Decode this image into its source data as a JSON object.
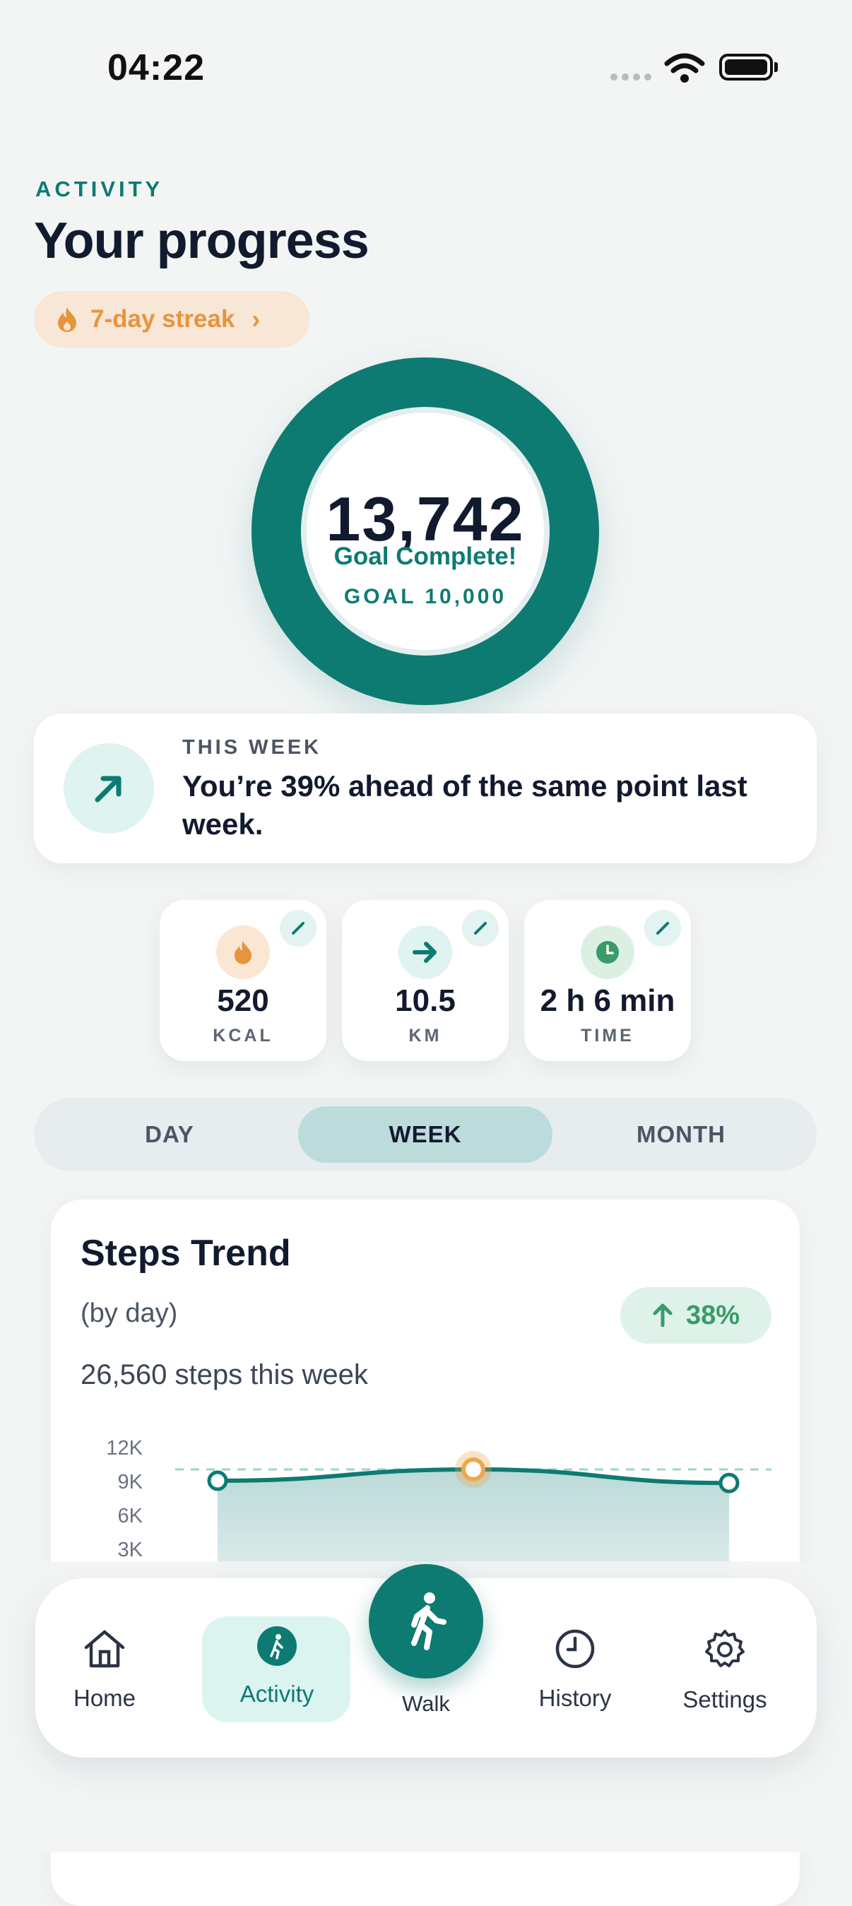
{
  "status_bar": {
    "time": "04:22"
  },
  "header": {
    "eyebrow": "ACTIVITY",
    "title": "Your progress",
    "streak_label": "7-day streak"
  },
  "progress": {
    "steps": "13,742",
    "status": "Goal Complete!",
    "goal": "GOAL 10,000",
    "fraction": 1.0
  },
  "week_card": {
    "eyebrow": "THIS WEEK",
    "text": "You’re 39% ahead of the same point last week."
  },
  "metrics": [
    {
      "value": "520",
      "unit": "KCAL",
      "icon": "flame-icon",
      "color": "#e6953d"
    },
    {
      "value": "10.5",
      "unit": "KM",
      "icon": "arrow-right-icon",
      "color": "#0d7b72"
    },
    {
      "value": "2 h 6 min",
      "unit": "TIME",
      "icon": "clock-icon",
      "color": "#3a9a6a"
    }
  ],
  "tabs": {
    "day": "DAY",
    "week": "WEEK",
    "month": "MONTH",
    "selected": "WEEK"
  },
  "steps_card": {
    "title": "Steps Trend",
    "subtitle": "(by day)",
    "total": "26,560 steps this week",
    "badge": "38%"
  },
  "chart_data": {
    "type": "area",
    "y_ticks": [
      "12K",
      "9K",
      "6K",
      "3K"
    ],
    "ylim": [
      0,
      12000
    ],
    "goal_line": 10000,
    "points": [
      9000,
      10000,
      8800
    ],
    "highlight_index": 1,
    "color": "#0d7b72",
    "highlight_color": "#f0a64a"
  },
  "nav": {
    "home": "Home",
    "activity": "Activity",
    "walk": "Walk",
    "history": "History",
    "settings": "Settings"
  },
  "colors": {
    "accent": "#0d7b72",
    "streak": "#e6953d",
    "positive": "#3a9a6a",
    "background": "#f3f5f5"
  }
}
